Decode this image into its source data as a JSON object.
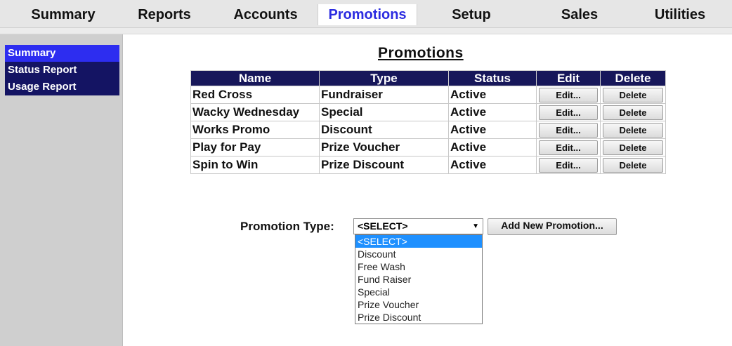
{
  "nav": {
    "tabs": [
      {
        "label": "Summary",
        "active": false
      },
      {
        "label": "Reports",
        "active": false
      },
      {
        "label": "Accounts",
        "active": false
      },
      {
        "label": "Promotions",
        "active": true
      },
      {
        "label": "Setup",
        "active": false
      },
      {
        "label": "Sales",
        "active": false
      },
      {
        "label": "Utilities",
        "active": false
      }
    ]
  },
  "sidebar": {
    "items": [
      {
        "label": "Summary",
        "active": true
      },
      {
        "label": "Status Report",
        "active": false
      },
      {
        "label": "Usage Report",
        "active": false
      }
    ]
  },
  "main": {
    "title": "Promotions",
    "table": {
      "headers": [
        "Name",
        "Type",
        "Status",
        "Edit",
        "Delete"
      ],
      "rows": [
        {
          "name": "Red Cross",
          "type": "Fundraiser",
          "status": "Active",
          "edit_label": "Edit...",
          "delete_label": "Delete"
        },
        {
          "name": "Wacky Wednesday",
          "type": "Special",
          "status": "Active",
          "edit_label": "Edit...",
          "delete_label": "Delete"
        },
        {
          "name": "Works Promo",
          "type": "Discount",
          "status": "Active",
          "edit_label": "Edit...",
          "delete_label": "Delete"
        },
        {
          "name": "Play for Pay",
          "type": "Prize Voucher",
          "status": "Active",
          "edit_label": "Edit...",
          "delete_label": "Delete"
        },
        {
          "name": "Spin to Win",
          "type": "Prize Discount",
          "status": "Active",
          "edit_label": "Edit...",
          "delete_label": "Delete"
        }
      ]
    },
    "promotion_type": {
      "label": "Promotion Type:",
      "selected": "<SELECT>",
      "options": [
        "<SELECT>",
        "Discount",
        "Free Wash",
        "Fund Raiser",
        "Special",
        "Prize Voucher",
        "Prize Discount"
      ],
      "add_button_label": "Add New Promotion..."
    }
  },
  "colors": {
    "nav_active_text": "#2b2be0",
    "header_bg": "#17175a",
    "sidebar_menu_bg": "#141463",
    "sidebar_active_bg": "#2d2df0",
    "dropdown_highlight": "#1e90ff"
  },
  "icons": {
    "select_arrow": "dropdown-arrow-icon"
  }
}
